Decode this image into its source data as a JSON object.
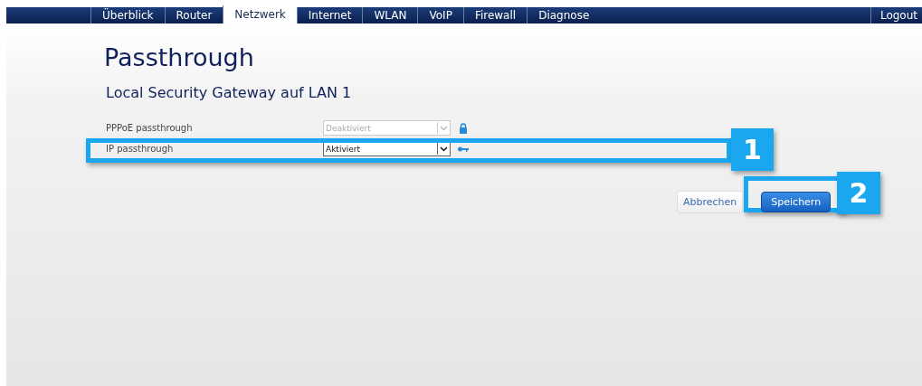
{
  "nav": {
    "tabs": [
      {
        "label": "Überblick",
        "selected": false
      },
      {
        "label": "Router",
        "selected": false
      },
      {
        "label": "Netzwerk",
        "selected": true
      },
      {
        "label": "Internet",
        "selected": false
      },
      {
        "label": "WLAN",
        "selected": false
      },
      {
        "label": "VoIP",
        "selected": false
      },
      {
        "label": "Firewall",
        "selected": false
      },
      {
        "label": "Diagnose",
        "selected": false
      }
    ],
    "logout": "Logout"
  },
  "title": "Passthrough",
  "subtitle": "Local Security Gateway auf LAN 1",
  "settings": [
    {
      "label": "PPPoE passthrough",
      "value": "Deaktiviert",
      "disabled": true,
      "kind": "locked"
    },
    {
      "label": "IP passthrough",
      "value": "Aktiviert",
      "disabled": false,
      "kind": "keyed"
    }
  ],
  "buttons": {
    "cancel": "Abbrechen",
    "save": "Speichern"
  },
  "callouts": [
    {
      "number": "1"
    },
    {
      "number": "2"
    }
  ]
}
